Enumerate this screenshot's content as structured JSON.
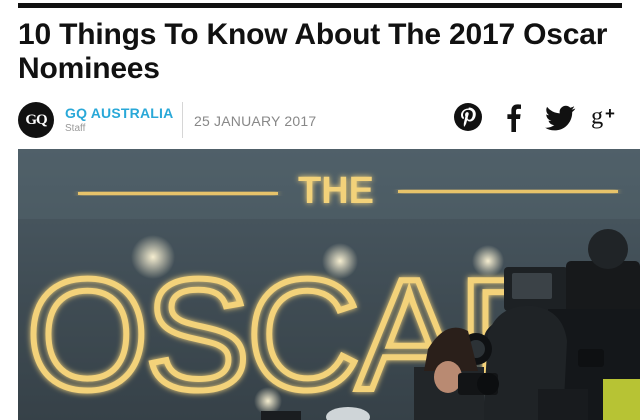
{
  "article": {
    "title": "10 Things To Know About The 2017 Oscar Nominees"
  },
  "byline": {
    "avatar_text": "GQ",
    "author": "GQ AUSTRALIA",
    "role": "Staff",
    "date": "25 JANUARY 2017"
  },
  "share": {
    "icons": [
      "pinterest-icon",
      "facebook-icon",
      "twitter-icon",
      "google-plus-icon"
    ]
  },
  "hero": {
    "line1": "THE",
    "line2": "OSCARS"
  },
  "colors": {
    "author_link": "#29a8d8",
    "gold": "#f3d27a",
    "text": "#111111"
  }
}
